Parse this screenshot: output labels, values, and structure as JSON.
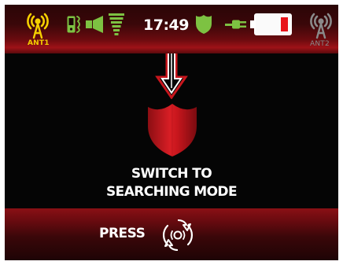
{
  "status_bar": {
    "antenna_1": {
      "label": "ANT1",
      "icon": "antenna-icon",
      "state": "active",
      "color": "#f5d000"
    },
    "phone_icon": "phone-icon",
    "signal_waves_icon": "signal-waves-icon",
    "speaker_icon": "speaker-icon",
    "signal_strength_icon": "signal-strength-icon",
    "time": "17:49",
    "shield_icon": "shield-icon",
    "plug_icon": "power-plug-icon",
    "battery": {
      "icon": "battery-icon",
      "level": 0.12,
      "level_color": "#e8131a"
    },
    "antenna_2": {
      "label": "ANT2",
      "icon": "antenna-icon",
      "state": "inactive",
      "color": "#8a8a8a"
    }
  },
  "main": {
    "arrow_icon": "down-arrow-icon",
    "mode_icon": "red-shield-icon",
    "message_line_1": "SWITCH TO",
    "message_line_2": "SEARCHING MODE"
  },
  "footer": {
    "press_label": "PRESS",
    "button_icon": "rotate-button-icon"
  },
  "colors": {
    "accent_green": "#7dc242",
    "accent_red": "#c8161d",
    "accent_yellow": "#f5d000",
    "background": "#050505"
  }
}
